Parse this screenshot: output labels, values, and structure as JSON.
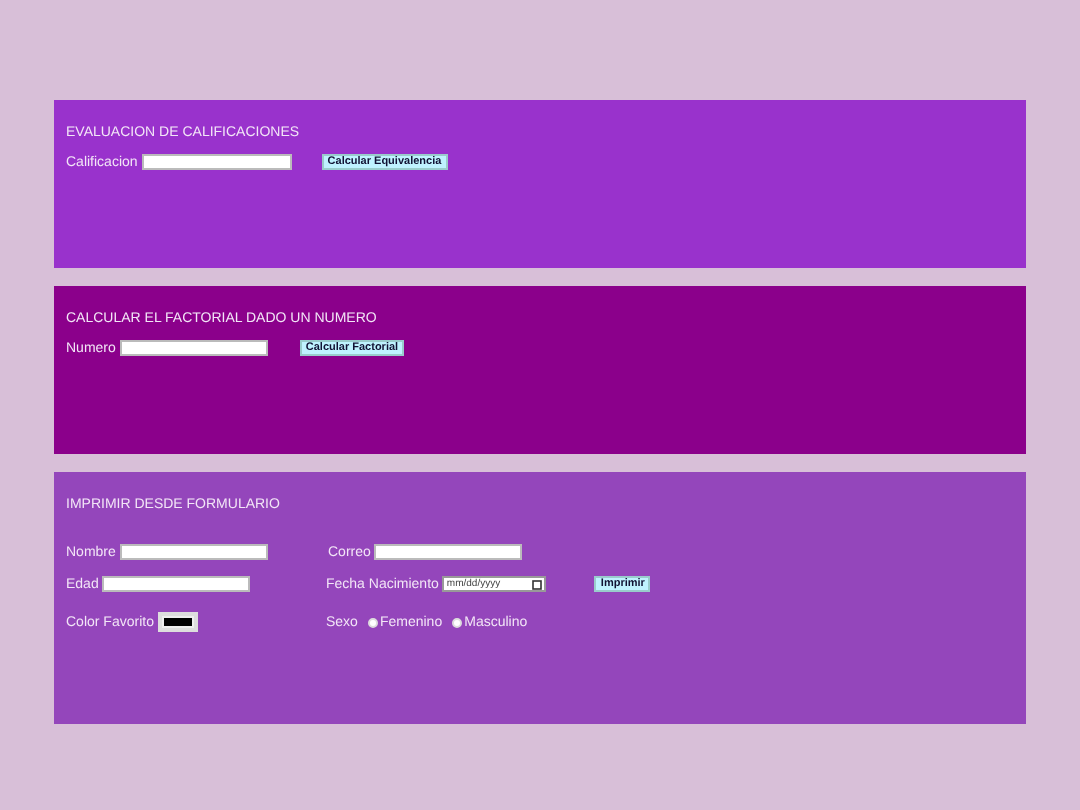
{
  "panels": [
    {
      "kind": "grade",
      "title": "EVALUACION DE CALIFICACIONES",
      "label": "Calificacion",
      "button": "Calcular Equivalencia"
    },
    {
      "kind": "factorial",
      "title": "CALCULAR EL FACTORIAL DADO UN NUMERO",
      "label": "Numero",
      "button": "Calcular Factorial"
    },
    {
      "kind": "form",
      "title": "IMPRIMIR DESDE FORMULARIO",
      "name_label": "Nombre",
      "email_label": "Correo",
      "age_label": "Edad",
      "birth_label": "Fecha Nacimiento",
      "birth_placeholder": "mm/dd/yyyy",
      "button": "Imprimir",
      "color_label": "Color Favorito",
      "color": "#000000",
      "sex_label": "Sexo",
      "sex_options": [
        {
          "label": "Femenino",
          "selected": false
        },
        {
          "label": "Masculino",
          "selected": false
        }
      ]
    }
  ]
}
